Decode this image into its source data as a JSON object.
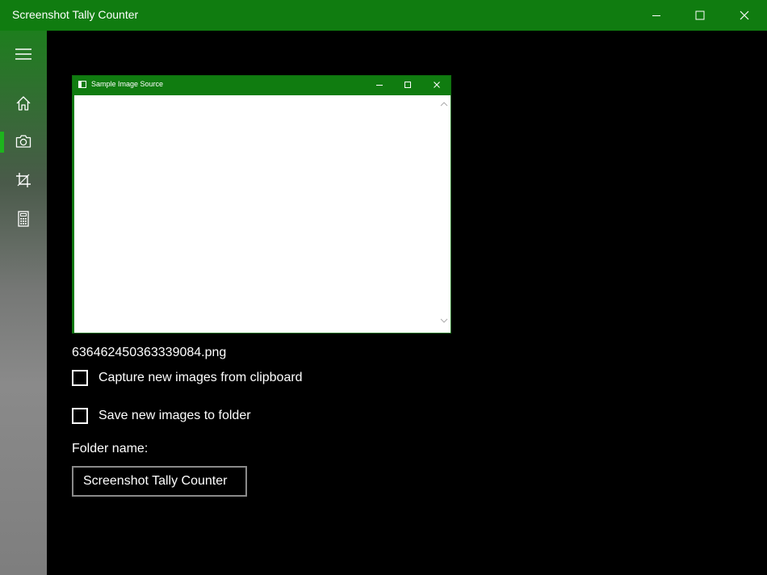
{
  "window": {
    "title": "Screenshot Tally Counter",
    "controls": [
      "minimize-icon",
      "maximize-icon",
      "close-icon"
    ]
  },
  "sidebar": {
    "items": [
      {
        "icon": "hamburger-menu-icon",
        "selected": false
      },
      {
        "icon": "home-icon",
        "selected": false
      },
      {
        "icon": "camera-icon",
        "selected": true
      },
      {
        "icon": "crop-icon",
        "selected": false
      },
      {
        "icon": "calculator-icon",
        "selected": false
      }
    ]
  },
  "preview": {
    "window_title": "Sample Image Source"
  },
  "main": {
    "filename": "636462450363339084.png",
    "capture_checkbox": {
      "label": "Capture new images from clipboard",
      "checked": false
    },
    "save_checkbox": {
      "label": "Save new images to folder",
      "checked": false
    },
    "folder_label": "Folder name:",
    "folder_value": "Screenshot Tally Counter"
  },
  "colors": {
    "accent": "#107c10",
    "background": "#000000",
    "text": "#ffffff"
  }
}
